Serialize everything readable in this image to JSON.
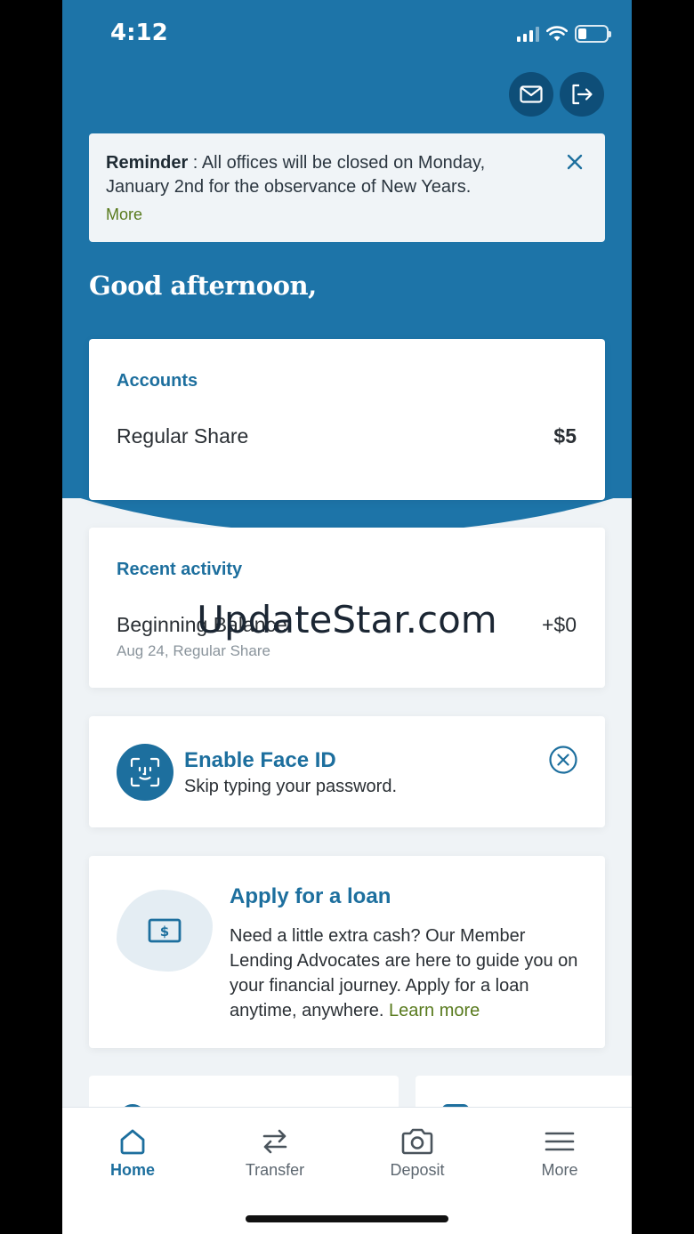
{
  "status_bar": {
    "time": "4:12"
  },
  "header": {
    "icons": {
      "message": "mail-icon",
      "logout": "logout-icon"
    }
  },
  "reminder": {
    "label": "Reminder",
    "message": " : All offices will be closed on Monday, January 2nd for the observance of New Years.",
    "more": "More"
  },
  "greeting": "Good afternoon,",
  "accounts": {
    "heading": "Accounts",
    "items": [
      {
        "name": "Regular Share",
        "amount": "$5"
      }
    ]
  },
  "recent_activity": {
    "heading": "Recent activity",
    "items": [
      {
        "name": "Beginning Balance",
        "amount": "+$0",
        "detail": "Aug 24, Regular Share"
      }
    ]
  },
  "face_id": {
    "title": "Enable Face ID",
    "subtitle": "Skip typing your password."
  },
  "loan": {
    "title": "Apply for a loan",
    "body": "Need a little extra cash? Our Member Lending Advocates are here to guide you on your financial journey. Apply for a loan anytime, anywhere. ",
    "link": "Learn more"
  },
  "tabs": [
    {
      "label": "Home",
      "icon": "home-icon",
      "active": true
    },
    {
      "label": "Transfer",
      "icon": "transfer-icon",
      "active": false
    },
    {
      "label": "Deposit",
      "icon": "camera-icon",
      "active": false
    },
    {
      "label": "More",
      "icon": "menu-icon",
      "active": false
    }
  ],
  "watermark": "UpdateStar.com",
  "colors": {
    "brand_blue": "#1d74a8",
    "accent_text": "#1d6f9e",
    "link_green": "#587a1d"
  }
}
